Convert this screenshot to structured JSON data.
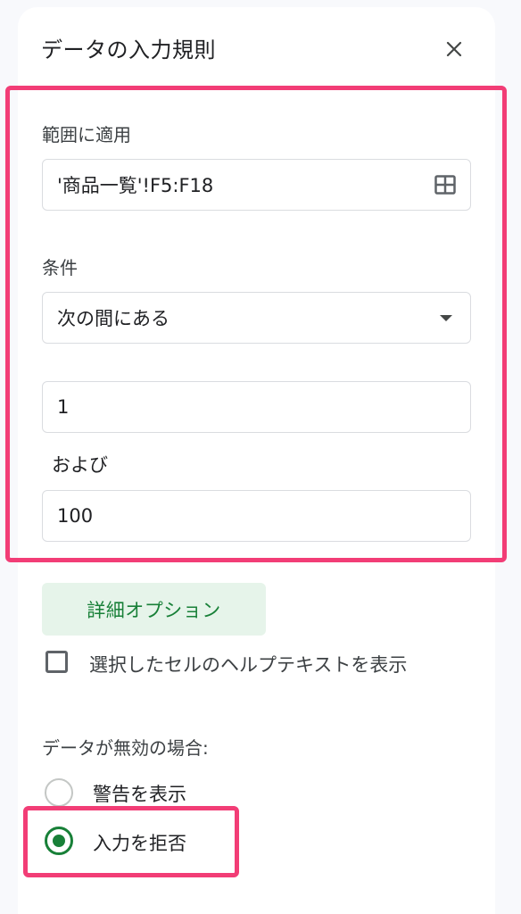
{
  "panel": {
    "title": "データの入力規則"
  },
  "range": {
    "label": "範囲に適用",
    "value": "'商品一覧'!F5:F18"
  },
  "criteria": {
    "label": "条件",
    "selected": "次の間にある",
    "min_value": "1",
    "between_label": "および",
    "max_value": "100"
  },
  "advanced": {
    "button_label": "詳細オプション"
  },
  "help": {
    "checkbox_label": "選択したセルのヘルプテキストを表示",
    "checked": false
  },
  "invalid": {
    "label": "データが無効の場合:",
    "options": [
      {
        "label": "警告を表示",
        "selected": false
      },
      {
        "label": "入力を拒否",
        "selected": true
      }
    ]
  },
  "colors": {
    "highlight": "#f23d76",
    "accent_green": "#188038",
    "advanced_bg": "#e6f4ea"
  },
  "icons": [
    "close-icon",
    "grid-icon",
    "dropdown-arrow-icon",
    "checkbox-icon",
    "radio-icon"
  ]
}
